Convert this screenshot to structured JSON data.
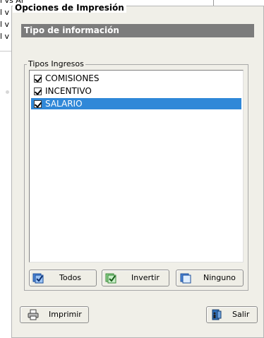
{
  "background": {
    "rows": [
      "l vs Anterior",
      "l v",
      "l v",
      "l v"
    ]
  },
  "panel": {
    "title": "Opciones de Impresión",
    "info_bar": "Tipo de información",
    "group_title": "Tipos Ingresos",
    "items": [
      {
        "label": "COMISIONES",
        "checked": true,
        "selected": false
      },
      {
        "label": "INCENTIVO",
        "checked": true,
        "selected": false
      },
      {
        "label": "SALARIO",
        "checked": true,
        "selected": true
      }
    ]
  },
  "buttons": {
    "all_label": "Todos",
    "invert_label": "Invertir",
    "none_label": "Ninguno",
    "print_label": "Imprimir",
    "exit_label": "Salir"
  },
  "colors": {
    "selection": "#3088d8",
    "info_bar": "#7c7c7c",
    "panel": "#f0efe8"
  }
}
